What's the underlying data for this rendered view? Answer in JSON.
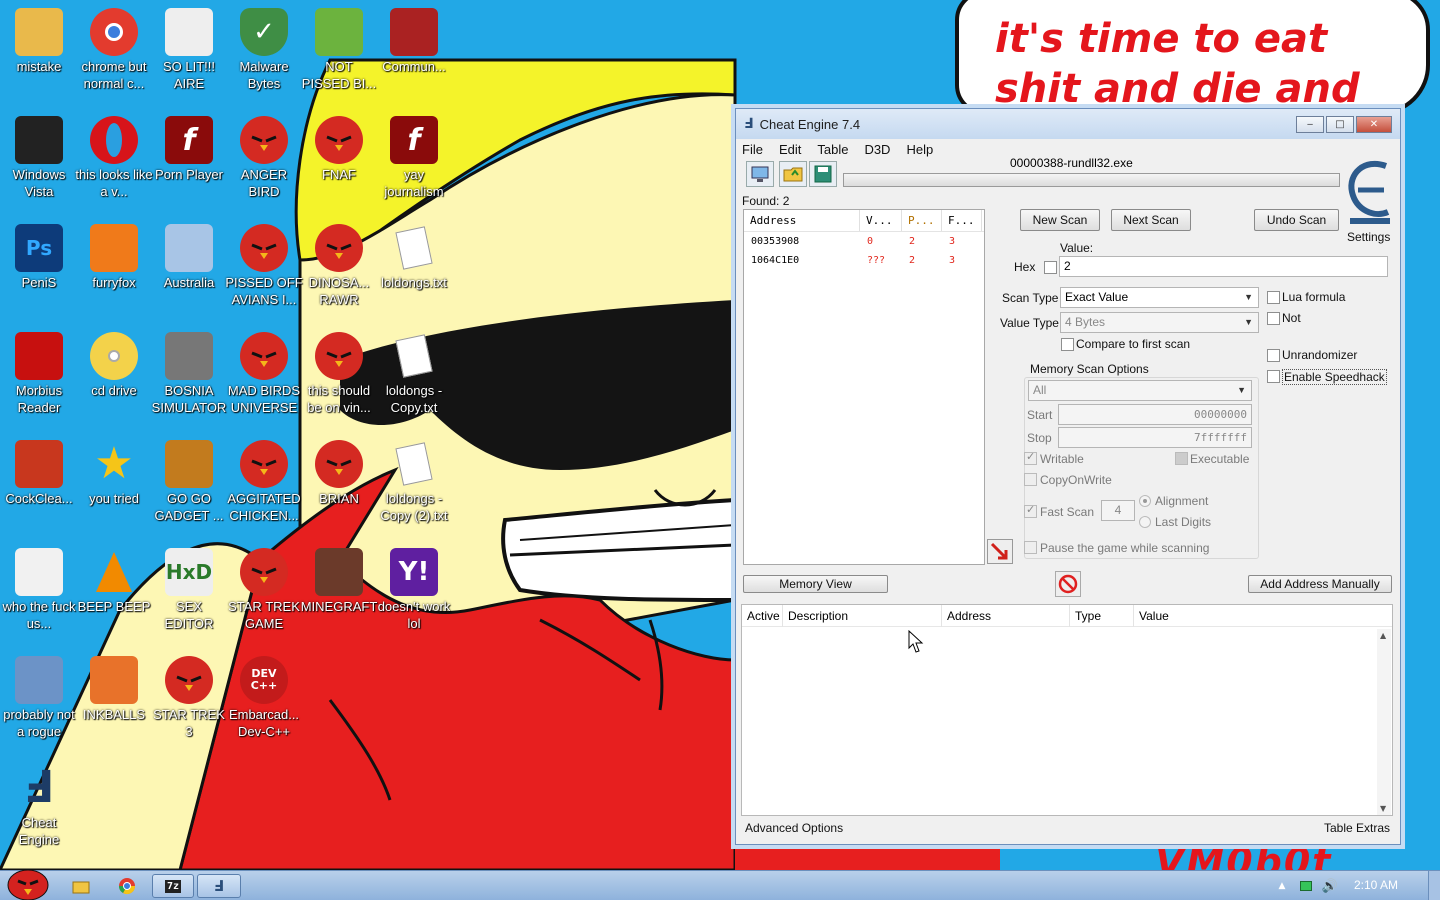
{
  "wallpaper": {
    "speech_text": "it's time to eat shit and die and chew",
    "bottom_text": "VM0b0t"
  },
  "desktop_icons": [
    {
      "label": "mistake",
      "icon": "folder-monitor-icon"
    },
    {
      "label": "chrome but normal c...",
      "icon": "chrome-icon"
    },
    {
      "label": "SO LIT!!! AIRE",
      "icon": "cards-icon"
    },
    {
      "label": "Malware Bytes",
      "icon": "shield-icon"
    },
    {
      "label": "NOT PISSED BI...",
      "icon": "pig-icon"
    },
    {
      "label": "Commun...",
      "icon": "tf2-icon"
    },
    {
      "label": "Windows Vista",
      "icon": "trash-icon"
    },
    {
      "label": "this looks like a v...",
      "icon": "opera-icon"
    },
    {
      "label": "Porn Player",
      "icon": "flash-icon"
    },
    {
      "label": "ANGER BIRD",
      "icon": "angry-bird-icon"
    },
    {
      "label": "FNAF",
      "icon": "angry-bird-icon"
    },
    {
      "label": "yay journalism",
      "icon": "flash-icon"
    },
    {
      "label": "PeniS",
      "icon": "photoshop-icon"
    },
    {
      "label": "furryfox",
      "icon": "firefox-icon"
    },
    {
      "label": "Australia",
      "icon": "spider-icon"
    },
    {
      "label": "PISSED OFF AVIANS I...",
      "icon": "angry-bird-seasons-icon"
    },
    {
      "label": "DINOSA... RAWR",
      "icon": "angry-bird-icon"
    },
    {
      "label": "loldongs.txt",
      "icon": "text-file-icon"
    },
    {
      "label": "Morbius Reader",
      "icon": "acrobat-icon"
    },
    {
      "label": "cd drive",
      "icon": "cd-icon"
    },
    {
      "label": "BOSNIA SIMULATOR",
      "icon": "mine-icon"
    },
    {
      "label": "MAD BIRDS UNIVERSE",
      "icon": "angry-bird-space-icon"
    },
    {
      "label": "this should be on vin...",
      "icon": "angry-bird-icon"
    },
    {
      "label": "loldongs - Copy.txt",
      "icon": "text-file-icon"
    },
    {
      "label": "CockClea...",
      "icon": "ccleaner-icon"
    },
    {
      "label": "you tried",
      "icon": "star-icon"
    },
    {
      "label": "GO GO GADGET ...",
      "icon": "briefcase-icon"
    },
    {
      "label": "AGGITATED CHICKEN...",
      "icon": "angry-bird-icon"
    },
    {
      "label": "BRIAN",
      "icon": "angry-bird-slingshot-icon"
    },
    {
      "label": "loldongs - Copy (2).txt",
      "icon": "text-file-icon"
    },
    {
      "label": "who the fuck us...",
      "icon": "flash-bolt-icon"
    },
    {
      "label": "BEEP BEEP",
      "icon": "vlc-icon"
    },
    {
      "label": "SEX EDITOR",
      "icon": "hxd-icon"
    },
    {
      "label": "STAR TREK GAME",
      "icon": "angry-bird-starwars-icon"
    },
    {
      "label": "MINEGRAFT",
      "icon": "minecraft-icon"
    },
    {
      "label": "doesn't work lol",
      "icon": "yahoo-icon"
    },
    {
      "label": "probably not a rogue",
      "icon": "gear-icon"
    },
    {
      "label": "INKBALLS",
      "icon": "inkball-icon"
    },
    {
      "label": "STAR TREK 3",
      "icon": "angry-bird-starwars-icon"
    },
    {
      "label": "Embarcad... Dev-C++",
      "icon": "devcpp-icon"
    },
    {
      "label": "Cheat Engine",
      "icon": "cheat-engine-icon"
    }
  ],
  "ce": {
    "title": "Cheat Engine 7.4",
    "menu": [
      "File",
      "Edit",
      "Table",
      "D3D",
      "Help"
    ],
    "process": "00000388-rundll32.exe",
    "found": "Found: 2",
    "found_columns": [
      "Address",
      "V...",
      "P...",
      "F..."
    ],
    "found_rows": [
      {
        "address": "00353908",
        "value": "0",
        "prev": "2",
        "first": "3"
      },
      {
        "address": "1064C1E0",
        "value": "???",
        "prev": "2",
        "first": "3"
      }
    ],
    "buttons": {
      "new_scan": "New Scan",
      "next_scan": "Next Scan",
      "undo_scan": "Undo Scan",
      "memory_view": "Memory View",
      "add_address": "Add Address Manually"
    },
    "settings": "Settings",
    "value_label": "Value:",
    "hex_label": "Hex",
    "value": "2",
    "scan_type_label": "Scan Type",
    "scan_type": "Exact Value",
    "value_type_label": "Value Type",
    "value_type": "4 Bytes",
    "compare_first": "Compare to first scan",
    "lua_formula": "Lua formula",
    "not": "Not",
    "unrandomizer": "Unrandomizer",
    "enable_speedhack": "Enable Speedhack",
    "mem_options": "Memory Scan Options",
    "region": "All",
    "start_label": "Start",
    "start": "00000000",
    "stop_label": "Stop",
    "stop": "7fffffff",
    "writable": "Writable",
    "executable": "Executable",
    "copyonwrite": "CopyOnWrite",
    "fast_scan": "Fast Scan",
    "fast_scan_value": "4",
    "alignment": "Alignment",
    "last_digits": "Last Digits",
    "pause_game": "Pause the game while scanning",
    "table_columns": [
      "Active",
      "Description",
      "Address",
      "Type",
      "Value"
    ],
    "advanced_options": "Advanced Options",
    "table_extras": "Table Extras"
  },
  "taskbar": {
    "clock": "2:10 AM",
    "pinned": [
      "angry-bird-start-icon",
      "explorer-icon",
      "chrome-icon",
      "7zip-icon",
      "cheat-engine-icon"
    ]
  }
}
